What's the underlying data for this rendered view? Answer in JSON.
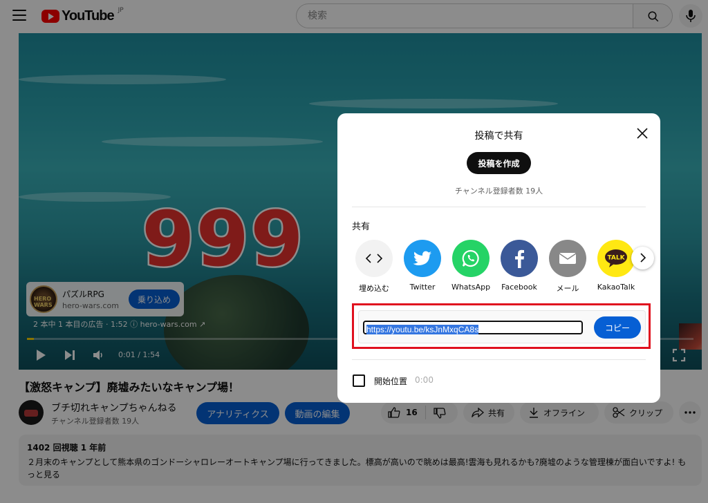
{
  "header": {
    "logo_text": "YouTube",
    "region": "JP",
    "search_placeholder": "検索"
  },
  "player": {
    "overlay_number": "999",
    "ad": {
      "logo_text": "HERO WARS",
      "title": "パズルRPG",
      "domain": "hero-wars.com",
      "cta": "乗り込め",
      "info": "2 本中 1 本目の広告 · 1:52 ⓘ   hero-wars.com ↗"
    },
    "time": "0:01 / 1:54",
    "progress": 0.01
  },
  "video": {
    "title": "【激怒キャンプ】廃墟みたいなキャンプ場！",
    "channel_name": "ブチ切れキャンプちゃんねる",
    "channel_subs": "チャンネル登録者数 19人",
    "analytics_btn": "アナリティクス",
    "edit_btn": "動画の編集",
    "like_count": "16",
    "share_btn": "共有",
    "offline_btn": "オフライン",
    "clip_btn": "クリップ"
  },
  "description": {
    "meta": "1402 回視聴  1 年前",
    "text": "２月末のキャンプとして熊本県のゴンドーシャロレーオートキャンプ場に行ってきました。標高が高いので眺めは最高!雲海も見れるかも?廃墟のような管理棟が面白いですよ! もっと見る"
  },
  "modal": {
    "title": "投稿で共有",
    "post_btn": "投稿を作成",
    "post_subs": "チャンネル登録者数 19人",
    "share_heading": "共有",
    "share_targets": [
      {
        "label": "埋め込む",
        "icon": "embed-icon",
        "color": "#f2f2f2"
      },
      {
        "label": "Twitter",
        "icon": "twitter-icon",
        "color": "#1d9bf0"
      },
      {
        "label": "WhatsApp",
        "icon": "whatsapp-icon",
        "color": "#25d366"
      },
      {
        "label": "Facebook",
        "icon": "facebook-icon",
        "color": "#3b5998"
      },
      {
        "label": "メール",
        "icon": "email-icon",
        "color": "#888888"
      },
      {
        "label": "KakaoTalk",
        "icon": "kakaotalk-icon",
        "color": "#ffe812"
      }
    ],
    "url": "https://youtu.be/ksJnMxqCA8s",
    "copy_btn": "コピー",
    "start_label": "開始位置",
    "start_time": "0:00"
  },
  "colors": {
    "accent": "#065fd4",
    "highlight": "#e0101e",
    "brand": "#ff0000"
  }
}
